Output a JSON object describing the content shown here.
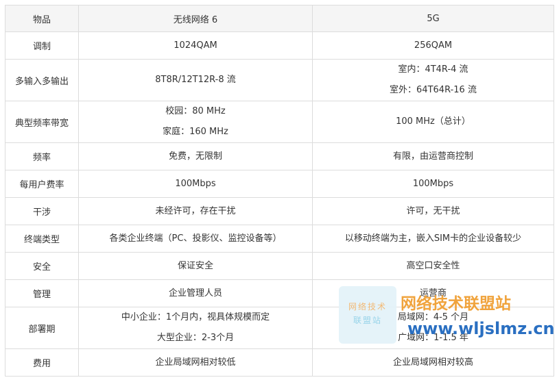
{
  "table": {
    "headers": [
      "物品",
      "无线网络 6",
      "5G"
    ],
    "rows": [
      {
        "item": "调制",
        "wifi6": [
          "1024QAM"
        ],
        "g5": [
          "256QAM"
        ]
      },
      {
        "item": "多输入多输出",
        "wifi6": [
          "8T8R/12T12R-8 流"
        ],
        "g5": [
          "室内：4T4R-4 流",
          "室外：64T64R-16 流"
        ]
      },
      {
        "item": "典型频率带宽",
        "wifi6": [
          "校园：80 MHz",
          "家庭：160 MHz"
        ],
        "g5": [
          "100 MHz（总计）"
        ]
      },
      {
        "item": "频率",
        "wifi6": [
          "免费，无限制"
        ],
        "g5": [
          "有限，由运营商控制"
        ]
      },
      {
        "item": "每用户费率",
        "wifi6": [
          "100Mbps"
        ],
        "g5": [
          "100Mbps"
        ]
      },
      {
        "item": "干涉",
        "wifi6": [
          "未经许可，存在干扰"
        ],
        "g5": [
          "许可，无干扰"
        ]
      },
      {
        "item": "终端类型",
        "wifi6": [
          "各类企业终端（PC、投影仪、监控设备等）"
        ],
        "g5": [
          "以移动终端为主，嵌入SIM卡的企业设备较少"
        ]
      },
      {
        "item": "安全",
        "wifi6": [
          "保证安全"
        ],
        "g5": [
          "高空口安全性"
        ]
      },
      {
        "item": "管理",
        "wifi6": [
          "企业管理人员"
        ],
        "g5": [
          "运营商"
        ]
      },
      {
        "item": "部署期",
        "wifi6": [
          "中小企业：1个月内，视具体规模而定",
          "大型企业：2-3个月"
        ],
        "g5": [
          "局域网：4-5 个月",
          "广域网：1-1.5 年"
        ]
      },
      {
        "item": "费用",
        "wifi6": [
          "企业局域网相对较低"
        ],
        "g5": [
          "企业局域网相对较高"
        ]
      }
    ]
  },
  "watermark": {
    "logo_line1": "网络技术",
    "logo_line2": "联盟站",
    "title": "网络技术联盟站",
    "url": "www.wljslmz.cn"
  }
}
